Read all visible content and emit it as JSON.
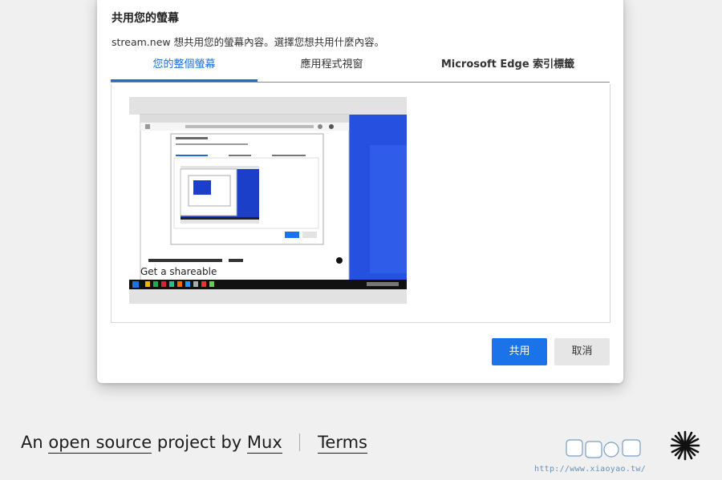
{
  "dialog": {
    "title": "共用您的螢幕",
    "description": "stream.new 想共用您的螢幕內容。選擇您想共用什麼內容。",
    "tabs": [
      {
        "label": "您的整個螢幕",
        "active": true
      },
      {
        "label": "應用程式視窗",
        "active": false
      },
      {
        "label": "Microsoft Edge 索引標籤",
        "active": false
      }
    ],
    "share_label": "共用",
    "cancel_label": "取消"
  },
  "footer": {
    "prefix": "An",
    "open_source_link": "open source",
    "middle": "project by",
    "mux_link": "Mux",
    "terms_link": "Terms"
  },
  "watermark": {
    "url": "http://www.xiaoyao.tw/"
  },
  "colors": {
    "accent": "#1a73e8",
    "tab_active": "#1a6cd6",
    "desktop_blue": "#1b3fc8",
    "page_bg": "#f0f0f0"
  }
}
